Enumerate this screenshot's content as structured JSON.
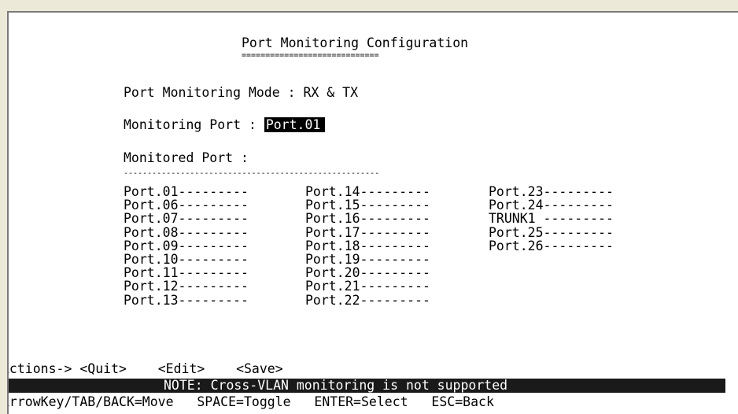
{
  "title": "Port Monitoring Configuration",
  "title_underline": "=============================",
  "mode": {
    "label": "Port Monitoring Mode : RX & TX"
  },
  "monitoring_port": {
    "label": "Monitoring Port : ",
    "value": "Port.01"
  },
  "monitored": {
    "label": "Monitored Port :",
    "separator": "------------------------------------------------------",
    "columns": [
      [
        "Port.01---------",
        "Port.06---------",
        "Port.07---------",
        "Port.08---------",
        "Port.09---------",
        "Port.10---------",
        "Port.11---------",
        "Port.12---------",
        "Port.13---------"
      ],
      [
        "Port.14---------",
        "Port.15---------",
        "Port.16---------",
        "Port.17---------",
        "Port.18---------",
        "Port.19---------",
        "Port.20---------",
        "Port.21---------",
        "Port.22---------"
      ],
      [
        "Port.23---------",
        "Port.24---------",
        "TRUNK1 ---------",
        "Port.25---------",
        "Port.26---------"
      ]
    ]
  },
  "actions": {
    "prefix": "Actions->",
    "quit": "<Quit>",
    "edit": "<Edit>",
    "save": "<Save>"
  },
  "notice": "NOTE: Cross-VLAN monitoring is not supported",
  "help": {
    "move": "ArrowKey/TAB/BACK=Move",
    "toggle": "SPACE=Toggle",
    "select": "ENTER=Select",
    "back": "ESC=Back"
  }
}
